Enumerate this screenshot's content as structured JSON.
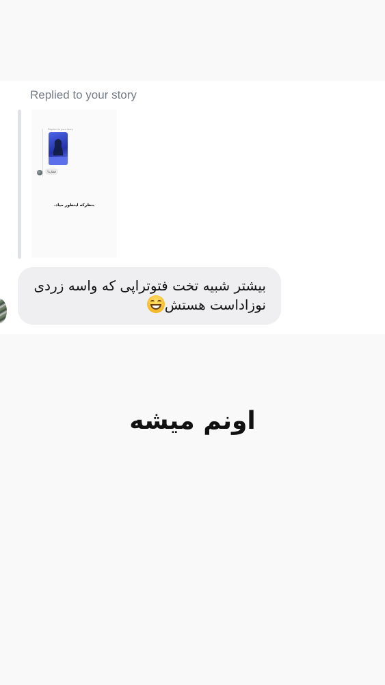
{
  "story_reply": {
    "label": "Replied to your story",
    "thumbnail": {
      "replied_label": "Replied to your story",
      "bubble_text": "قطاره؟",
      "overlay_text": "بنظرکه اینطور میاد."
    }
  },
  "message": {
    "line1": "بیشتر شبیه تخت فتوتراپی که واسه زردی",
    "line2": "نوزاداست هستش",
    "emoji_icon": "grinning-face-icon"
  },
  "caption": "اونم میشه",
  "colors": {
    "bubble": "#efeff1",
    "panel": "#ffffff",
    "background": "#f9f9f9",
    "label": "#737b85"
  }
}
